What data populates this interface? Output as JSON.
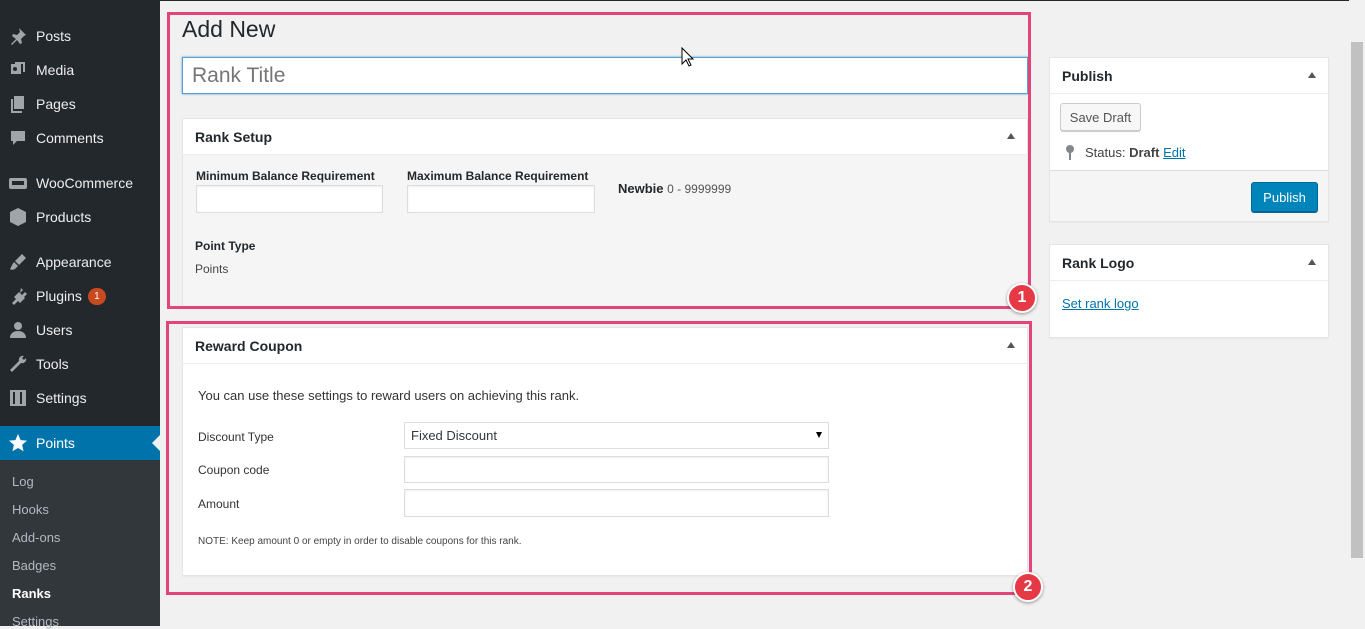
{
  "sidebar": {
    "items": [
      {
        "label": "Posts",
        "icon": "pin-icon"
      },
      {
        "label": "Media",
        "icon": "media-icon"
      },
      {
        "label": "Pages",
        "icon": "pages-icon"
      },
      {
        "label": "Comments",
        "icon": "comment-icon"
      },
      {
        "label": "WooCommerce",
        "icon": "woo-icon"
      },
      {
        "label": "Products",
        "icon": "box-icon"
      },
      {
        "label": "Appearance",
        "icon": "brush-icon"
      },
      {
        "label": "Plugins",
        "icon": "plug-icon",
        "badge": "1"
      },
      {
        "label": "Users",
        "icon": "user-icon"
      },
      {
        "label": "Tools",
        "icon": "wrench-icon"
      },
      {
        "label": "Settings",
        "icon": "settings-icon"
      },
      {
        "label": "Points",
        "icon": "star-icon"
      }
    ],
    "submenu": [
      "Log",
      "Hooks",
      "Add-ons",
      "Badges",
      "Ranks",
      "Settings"
    ]
  },
  "page": {
    "title": "Add New",
    "title_placeholder": "Rank Title"
  },
  "rank_setup": {
    "heading": "Rank Setup",
    "min_label": "Minimum Balance Requirement",
    "max_label": "Maximum Balance Requirement",
    "rank_name": "Newbie",
    "rank_range": "0 - 9999999",
    "point_type_label": "Point Type",
    "point_type_value": "Points"
  },
  "reward_coupon": {
    "heading": "Reward Coupon",
    "description": "You can use these settings to reward users on achieving this rank.",
    "discount_type_label": "Discount Type",
    "discount_type_value": "Fixed Discount",
    "coupon_code_label": "Coupon code",
    "amount_label": "Amount",
    "note": "NOTE: Keep amount 0 or empty in order to disable coupons for this rank."
  },
  "publish": {
    "heading": "Publish",
    "save_draft": "Save Draft",
    "status_label": "Status:",
    "status_value": "Draft",
    "edit_link": "Edit",
    "publish_button": "Publish"
  },
  "rank_logo": {
    "heading": "Rank Logo",
    "set_link": "Set rank logo"
  },
  "annotations": {
    "one": "1",
    "two": "2"
  },
  "colors": {
    "highlight": "#e2457c",
    "badge_red": "#e63946",
    "sidebar_bg": "#23282d",
    "active_blue": "#0073aa",
    "primary_button": "#0085ba"
  }
}
